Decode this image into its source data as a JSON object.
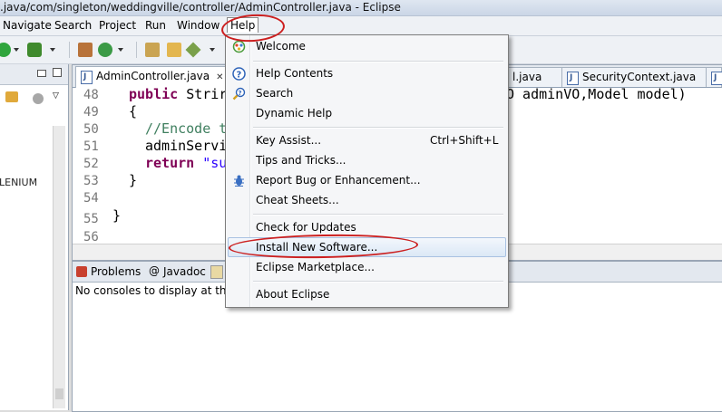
{
  "window": {
    "title": ".java/com/singleton/weddingville/controller/AdminController.java - Eclipse"
  },
  "menubar": {
    "items": [
      "Navigate",
      "Search",
      "Project",
      "Run",
      "Window",
      "Help"
    ]
  },
  "left_pane": {
    "label": "LENIUM"
  },
  "editor": {
    "tabs": [
      {
        "label": "AdminController.java",
        "close": "✕"
      },
      {
        "label": "l.java"
      },
      {
        "label": "SecurityContext.java"
      }
    ],
    "line_numbers": [
      "48",
      "49",
      "50",
      "51",
      "52",
      "53",
      "54",
      "55",
      "56"
    ],
    "code": {
      "l48_kw": "public",
      "l48_rest": " Strir",
      "l48_right": "O adminVO,Model model)",
      "l49": "{",
      "l50": "//Encode t",
      "l51": "adminServi",
      "l52_kw": "return",
      "l52_str": " \"su",
      "l53": "}",
      "l55": "}"
    }
  },
  "console": {
    "tabs": [
      "Problems",
      "Javadoc"
    ],
    "message": "No consoles to display at this ti"
  },
  "help_menu": {
    "items": [
      {
        "label": "Welcome",
        "icon": "welcome-icon"
      },
      {
        "label": "Help Contents",
        "icon": "help-icon"
      },
      {
        "label": "Search",
        "icon": "search-help-icon"
      },
      {
        "label": "Dynamic Help"
      },
      {
        "label": "Key Assist...",
        "accelerator": "Ctrl+Shift+L"
      },
      {
        "label": "Tips and Tricks..."
      },
      {
        "label": "Report Bug or Enhancement...",
        "icon": "bug-icon"
      },
      {
        "label": "Cheat Sheets..."
      },
      {
        "label": "Check for Updates"
      },
      {
        "label": "Install New Software..."
      },
      {
        "label": "Eclipse Marketplace..."
      },
      {
        "label": "About Eclipse"
      }
    ]
  },
  "colors": {
    "annotation": "#cc1f1f",
    "keyword": "#7f0055",
    "comment": "#3f7f5f",
    "string": "#2a00ff"
  }
}
